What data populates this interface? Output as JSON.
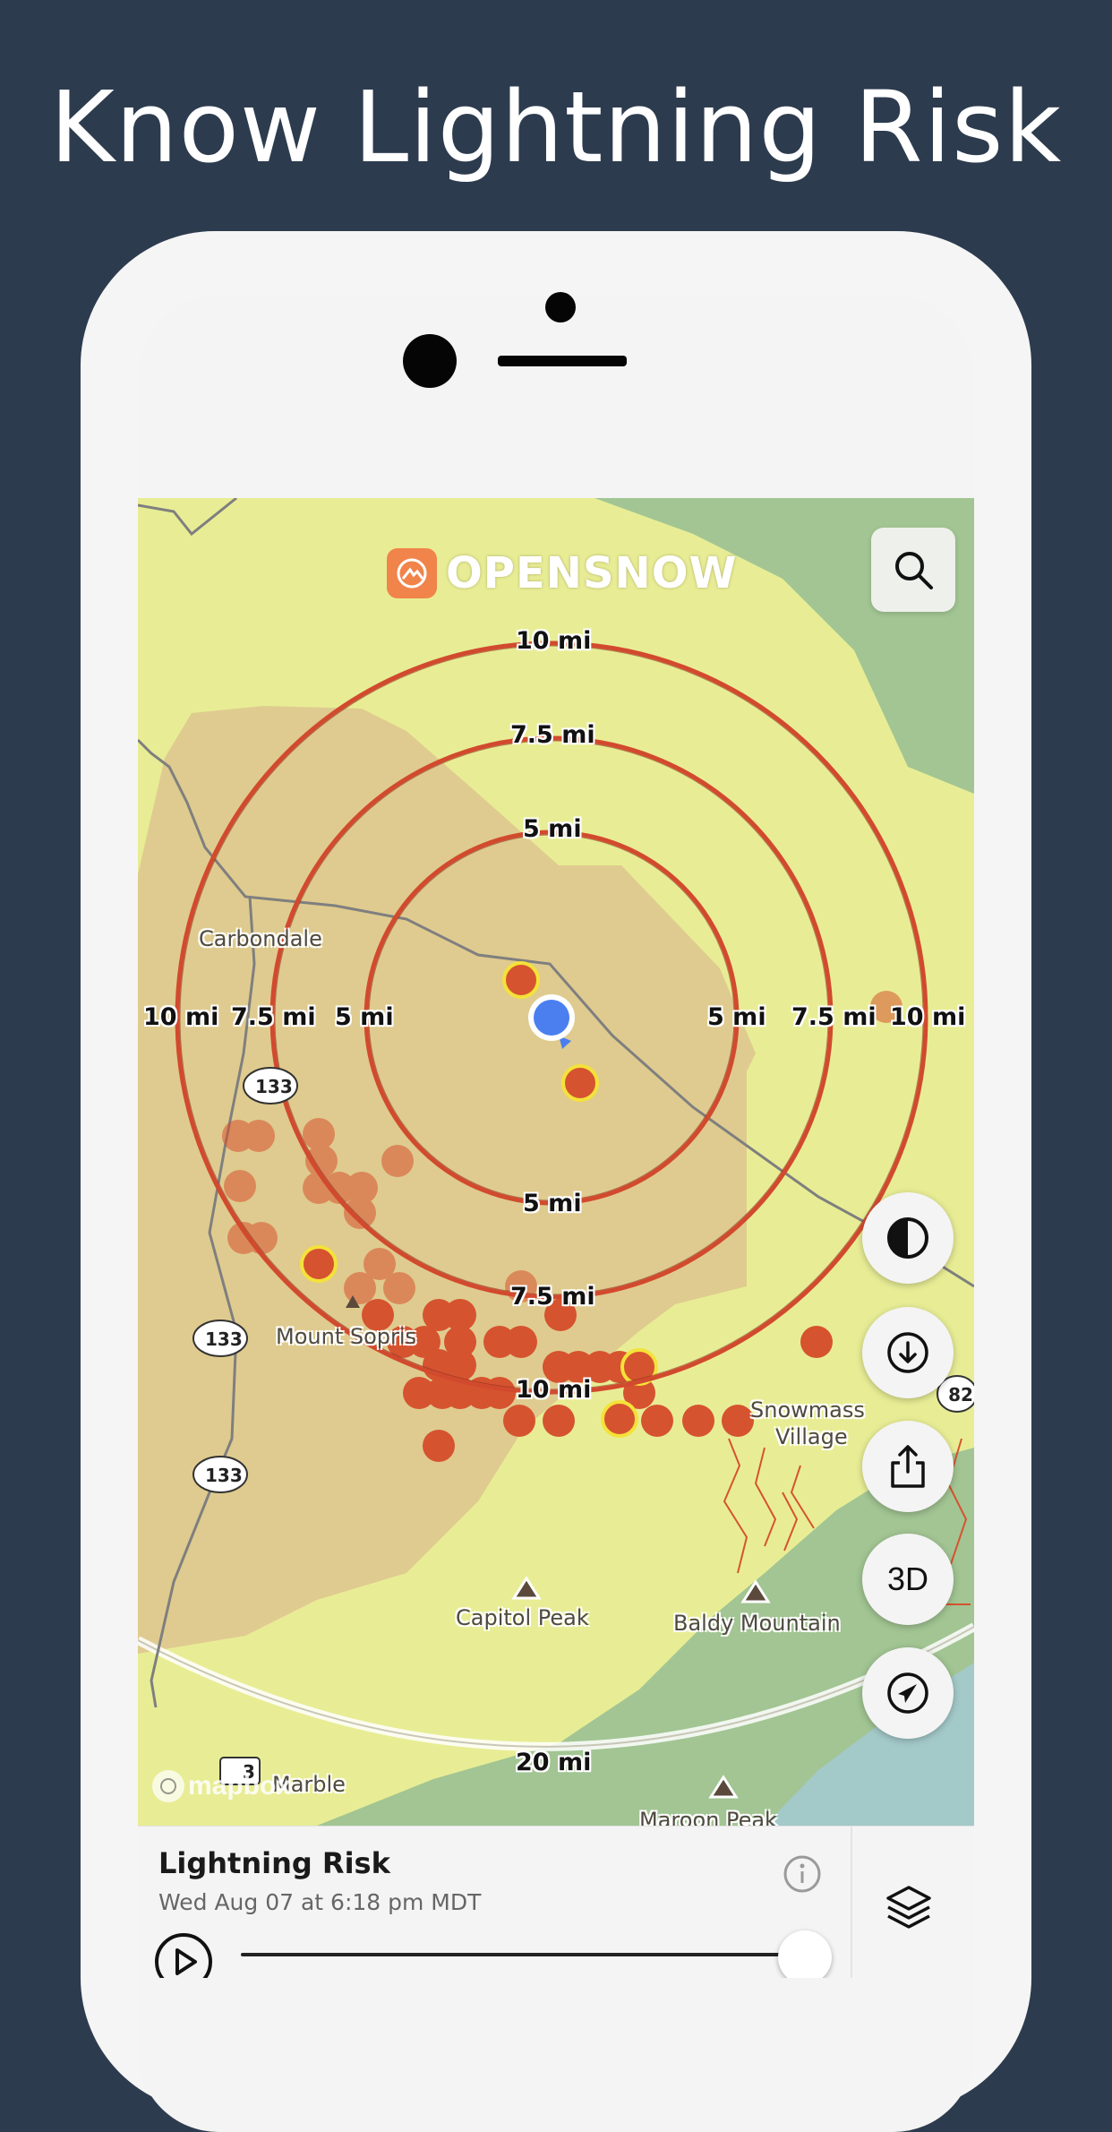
{
  "headline": "Know Lightning Risk",
  "brand": {
    "name": "OPENSNOW"
  },
  "map": {
    "ring_labels": {
      "ring_10_top": "10 mi",
      "ring_75_top": "7.5 mi",
      "ring_5_top": "5 mi",
      "ring_5_bottom": "5 mi",
      "ring_75_bottom": "7.5 mi",
      "ring_10_bottom": "10 mi",
      "left_10": "10 mi",
      "left_75": "7.5 mi",
      "left_5": "5 mi",
      "right_5": "5 mi",
      "right_75": "7.5 mi",
      "right_10": "10 mi",
      "ring_20_bottom": "20 mi"
    },
    "places": {
      "carbondale": "Carbondale",
      "mount_sopris": "Mount Sopris",
      "snowmass_line1": "Snowmass",
      "snowmass_line2": "Village",
      "capitol_peak": "Capitol Peak",
      "baldy_mountain": "Baldy Mountain",
      "maroon_peak": "Maroon Peak",
      "marble": "Marble"
    },
    "roads": {
      "hwy_133_a": "133",
      "hwy_133_b": "133",
      "hwy_133_c": "133",
      "hwy_82": "82",
      "hwy_3": "3"
    },
    "attribution": "mapbox",
    "colors": {
      "low_risk": "#e8ed95",
      "moderate_risk": "#dfcb8f",
      "forest": "#a2c593",
      "water": "#a4c9c9",
      "ring": "#d24a2e",
      "strike": "#d6532f",
      "recent_strike_outline": "#f4e23a",
      "user_location": "#4b7ff0"
    }
  },
  "controls": {
    "search_icon": "search-icon",
    "contrast_icon": "contrast-icon",
    "download_icon": "download-icon",
    "share_icon": "share-icon",
    "view_3d_label": "3D",
    "locate_icon": "location-arrow-icon"
  },
  "panel": {
    "title": "Lightning Risk",
    "subtitle": "Wed Aug 07 at 6:18 pm MDT",
    "timeline_position": 1.0
  }
}
